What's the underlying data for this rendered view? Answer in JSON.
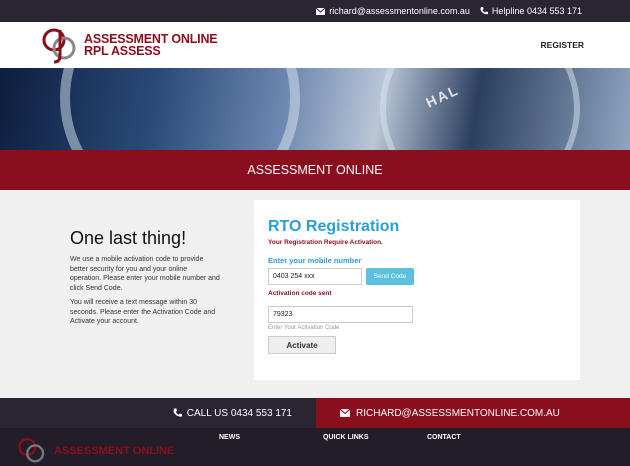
{
  "topbar": {
    "email": "richard@assessmentonline.com.au",
    "helpline": "Helpline 0434 553 171"
  },
  "header": {
    "logo_line1": "ASSESSMENT ONLINE",
    "logo_line2": "RPL ASSESS",
    "register_label": "REGISTER"
  },
  "hero": {
    "word": "HAL"
  },
  "banner": {
    "title": "ASSESSMENT ONLINE"
  },
  "intro": {
    "heading": "One last thing!",
    "para1": "We use a mobile activation code to provide better security for you and your online operation. Please enter your mobile number and click Send Code.",
    "para2": "You will receive a text message within 30 seconds. Please enter the Activation Code and Activate your account."
  },
  "form": {
    "title": "RTO Registration",
    "notice": "Your Registration Require Activation.",
    "mobile_label": "Enter your mobile number",
    "mobile_value": "0403 254 xxx",
    "send_label": "Send Code",
    "sent_label": "Activation code sent",
    "code_value": "79323",
    "code_placeholder": "Enter Your Activation Code",
    "activate_label": "Activate"
  },
  "contact": {
    "call": "CALL US 0434 553 171",
    "email": "RICHARD@ASSESSMENTONLINE.COM.AU"
  },
  "footer": {
    "logo": "ASSESSMENT ONLINE",
    "news": "NEWS",
    "quick_links": "QUICK LINKS",
    "contact": "CONTACT"
  },
  "colors": {
    "brand": "#8a0f1c",
    "accent": "#2b9fd9",
    "dark": "#2b2433"
  }
}
